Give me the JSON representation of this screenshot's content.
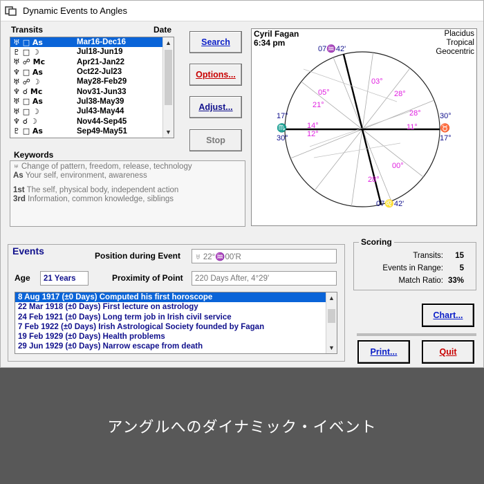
{
  "window": {
    "title": "Dynamic Events to Angles"
  },
  "transits": {
    "header_transits": "Transits",
    "header_date": "Date",
    "rows": [
      {
        "glyphs": "♅ □ As",
        "dates": "Mar16-Dec16"
      },
      {
        "glyphs": "♇ □ ☽",
        "dates": "Jul18-Jun19"
      },
      {
        "glyphs": "♅ ☍ Mc",
        "dates": "Apr21-Jan22"
      },
      {
        "glyphs": "♆ □ As",
        "dates": "Oct22-Jul23"
      },
      {
        "glyphs": "♅ ☍ ☽",
        "dates": "May28-Feb29"
      },
      {
        "glyphs": "♆ ☌ Mc",
        "dates": "Nov31-Jun33"
      },
      {
        "glyphs": "♅ □ As",
        "dates": "Jul38-May39"
      },
      {
        "glyphs": "♅ □ ☽",
        "dates": "Jul43-May44"
      },
      {
        "glyphs": "♆ ☌ ☽",
        "dates": "Nov44-Sep45"
      },
      {
        "glyphs": "♇ □ As",
        "dates": "Sep49-May51"
      }
    ],
    "selected_index": 0
  },
  "buttons": {
    "search": "Search",
    "options": "Options...",
    "adjust": "Adjust...",
    "stop": "Stop",
    "chart": "Chart...",
    "print": "Print...",
    "quit": "Quit"
  },
  "keywords": {
    "label": "Keywords",
    "lines": [
      {
        "glyph": "♅",
        "text": "Change of pattern, freedom, release, technology"
      },
      {
        "glyph": "As",
        "text": "Your self, environment, awareness"
      }
    ],
    "lines2": [
      {
        "glyph": "1st",
        "text": "The self, physical body, independent action"
      },
      {
        "glyph": "3rd",
        "text": "Information, common knowledge, siblings"
      }
    ]
  },
  "chart": {
    "name": "Cyril Fagan",
    "time": "6:34 pm",
    "system": [
      "Placidus",
      "Tropical",
      "Geocentric"
    ],
    "cusps": {
      "top_left": "07♒42'",
      "bottom_right": "07♌42'",
      "left_top": "17°",
      "left_sign": "♏",
      "left_bottom": "30°",
      "right_top": "30°",
      "right_sign": "♉",
      "right_bottom": "17°"
    },
    "labels": [
      "03°",
      "05°",
      "21°",
      "14°",
      "12°",
      "28°",
      "00°",
      "28°",
      "28°",
      "11°"
    ]
  },
  "events": {
    "label": "Events",
    "position_label": "Position during Event",
    "position_value": "♅ 22°♒00'R",
    "age_label": "Age",
    "age_value": "21 Years",
    "proximity_label": "Proximity of Point",
    "proximity_value": "220 Days After, 4°29'",
    "rows": [
      "8 Aug 1917 (±0 Days) Computed his first horoscope",
      "22 Mar 1918 (±0 Days) First lecture on astrology",
      "24 Feb 1921 (±0 Days) Long term job in Irish civil service",
      "7 Feb 1922 (±0 Days) Irish Astrological Society founded by Fagan",
      "19 Feb 1929 (±0 Days) Health problems",
      "29 Jun 1929 (±0 Days) Narrow escape from death"
    ],
    "selected_index": 0
  },
  "scoring": {
    "label": "Scoring",
    "transits_label": "Transits:",
    "transits_value": "15",
    "range_label": "Events in Range:",
    "range_value": "5",
    "ratio_label": "Match Ratio:",
    "ratio_value": "33%"
  },
  "caption": "アングルへのダイナミック・イベント",
  "colors": {
    "selection": "#0a64d8",
    "navy_text": "#10108c",
    "red": "#c80000",
    "link_blue": "#0a1ec8",
    "magenta": "#e020e0"
  }
}
